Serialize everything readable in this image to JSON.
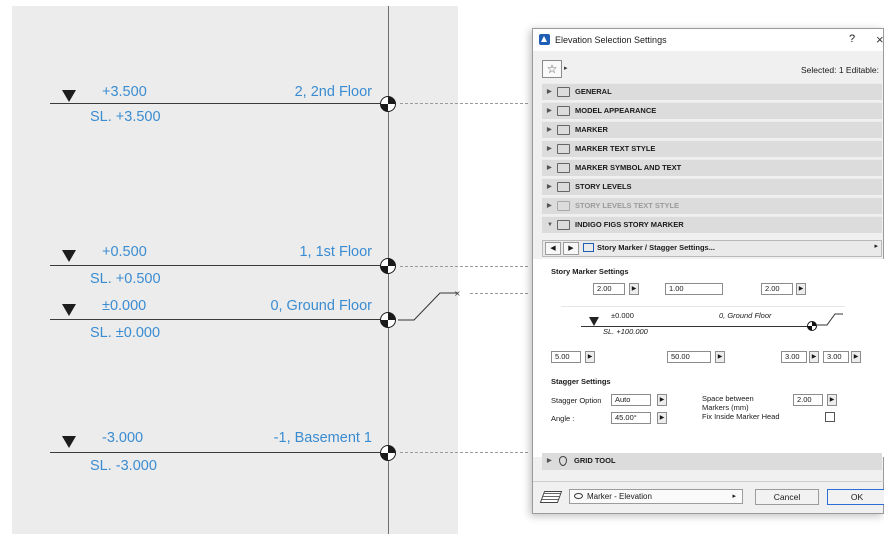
{
  "drawing": {
    "levels": [
      {
        "value": "+3.500",
        "sl": "SL. +3.500",
        "story": "2, 2nd Floor"
      },
      {
        "value": "+0.500",
        "sl": "SL. +0.500",
        "story": "1, 1st Floor"
      },
      {
        "value": "±0.000",
        "sl": "SL. ±0.000",
        "story": "0, Ground Floor"
      },
      {
        "value": "-3.000",
        "sl": "SL. -3.000",
        "story": "-1, Basement 1"
      }
    ]
  },
  "dialog": {
    "title": "Elevation Selection Settings",
    "help": "?",
    "close": "×",
    "selected_text": "Selected: 1 Editable:",
    "panels": [
      {
        "label": "GENERAL",
        "icon": "general-icon"
      },
      {
        "label": "MODEL APPEARANCE",
        "icon": "model-appearance-icon"
      },
      {
        "label": "MARKER",
        "icon": "marker-icon"
      },
      {
        "label": "MARKER TEXT STYLE",
        "icon": "text-style-icon"
      },
      {
        "label": "MARKER SYMBOL AND TEXT",
        "icon": "symbol-text-icon"
      },
      {
        "label": "STORY LEVELS",
        "icon": "story-levels-icon"
      },
      {
        "label": "STORY LEVELS TEXT STYLE",
        "icon": "text-style-icon"
      },
      {
        "label": "INDIGO FIGS STORY MARKER",
        "icon": "symbol-text-icon"
      }
    ],
    "subpage": "Story Marker / Stagger Settings...",
    "story_marker": {
      "heading": "Story Marker Settings",
      "top_fields": [
        "2.00",
        "1.00",
        "2.00"
      ],
      "preview_value": "±0.000",
      "preview_story": "0,  Ground Floor",
      "preview_sl": "SL. +100.000",
      "bottom_fields": [
        "5.00",
        "50.00",
        "3.00",
        "3.00"
      ]
    },
    "stagger": {
      "heading": "Stagger Settings",
      "option_label": "Stagger Option",
      "option_value": "Auto",
      "angle_label": "Angle :",
      "angle_value": "45.00°",
      "space_label_1": "Space between",
      "space_label_2": "Markers (mm)",
      "space_value": "2.00",
      "fix_label": "Fix Inside Marker Head"
    },
    "grid_tool": "GRID TOOL",
    "layer": "Marker - Elevation",
    "cancel": "Cancel",
    "ok": "OK"
  }
}
